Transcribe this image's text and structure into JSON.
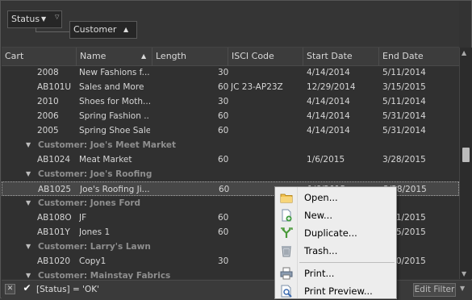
{
  "group_panel": {
    "chips": [
      {
        "label": "Status"
      },
      {
        "label": "Customer"
      }
    ]
  },
  "columns": [
    "Cart",
    "Name",
    "Length",
    "ISCI Code",
    "Start Date",
    "End Date"
  ],
  "rows": [
    {
      "type": "data",
      "cart": "2008",
      "name": "New Fashions f...",
      "length": "30",
      "isci": "",
      "start": "4/14/2014",
      "end": "5/11/2014"
    },
    {
      "type": "data",
      "cart": "AB101U",
      "name": "Sales and More",
      "length": "60",
      "isci": "JC 23-AP23Z",
      "start": "12/29/2014",
      "end": "3/15/2015"
    },
    {
      "type": "data",
      "cart": "2010",
      "name": "Shoes for Moth...",
      "length": "30",
      "isci": "",
      "start": "4/14/2014",
      "end": "5/11/2014"
    },
    {
      "type": "data",
      "cart": "2006",
      "name": "Spring Fashion ...",
      "length": "60",
      "isci": "",
      "start": "4/14/2014",
      "end": "5/31/2014"
    },
    {
      "type": "data",
      "cart": "2005",
      "name": "Spring Shoe Sale",
      "length": "60",
      "isci": "",
      "start": "4/14/2014",
      "end": "5/31/2014"
    },
    {
      "type": "group",
      "label": "Customer: Joe's Meet Market"
    },
    {
      "type": "data",
      "cart": "AB1024",
      "name": "Meat Market",
      "length": "60",
      "isci": "",
      "start": "1/6/2015",
      "end": "3/28/2015"
    },
    {
      "type": "group",
      "label": "Customer: Joe's Roofing"
    },
    {
      "type": "data",
      "selected": true,
      "cart": "AB1025",
      "name": "Joe's Roofing Ji...",
      "length": "60",
      "isci": "",
      "start": "1/6/2015",
      "end": "3/28/2015"
    },
    {
      "type": "group",
      "label": "Customer: Jones Ford"
    },
    {
      "type": "data",
      "cart": "AB108O",
      "name": "JF",
      "length": "60",
      "isci": "",
      "start": "",
      "end": "3/31/2015"
    },
    {
      "type": "data",
      "cart": "AB101Y",
      "name": "Jones 1",
      "length": "60",
      "isci": "",
      "start": "",
      "end": "4/25/2015"
    },
    {
      "type": "group",
      "label": "Customer: Larry's Lawn"
    },
    {
      "type": "data",
      "cart": "AB1020",
      "name": "Copy1",
      "length": "30",
      "isci": "",
      "start": "",
      "end": "4/20/2015"
    },
    {
      "type": "group",
      "label": "Customer: Mainstay Fabrics"
    }
  ],
  "filter_bar": {
    "clear_label": "✕",
    "check": "✔",
    "text": "[Status] = 'OK'",
    "edit_label": "Edit Filter"
  },
  "context_menu": {
    "items": [
      {
        "label": "Open...",
        "icon": "folder-icon"
      },
      {
        "label": "New...",
        "icon": "new-document-icon"
      },
      {
        "label": "Duplicate...",
        "icon": "duplicate-icon"
      },
      {
        "label": "Trash...",
        "icon": "trash-icon"
      },
      {
        "label": "Print...",
        "icon": "printer-icon"
      },
      {
        "label": "Print Preview...",
        "icon": "print-preview-icon"
      }
    ]
  },
  "colors": {
    "background": "#303030",
    "group_text": "#8e8e8e",
    "menu_background": "#ededed"
  }
}
